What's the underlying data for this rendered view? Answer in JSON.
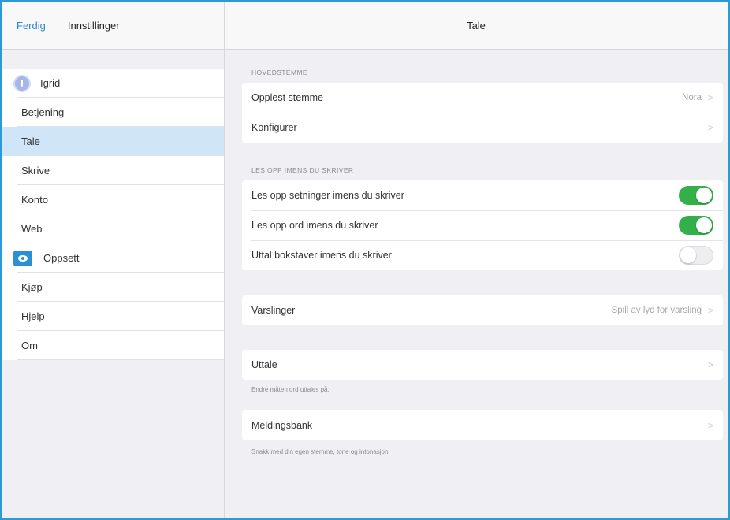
{
  "sidebar": {
    "done_label": "Ferdig",
    "title": "Innstillinger",
    "items": [
      {
        "label": "Igrid",
        "icon": "user-avatar-icon"
      },
      {
        "label": "Betjening"
      },
      {
        "label": "Tale",
        "active": true
      },
      {
        "label": "Skrive"
      },
      {
        "label": "Konto"
      },
      {
        "label": "Web"
      },
      {
        "label": "Oppsett",
        "icon": "eye-icon"
      },
      {
        "label": "Kjøp"
      },
      {
        "label": "Hjelp"
      },
      {
        "label": "Om"
      }
    ]
  },
  "main": {
    "title": "Tale",
    "voice_section": {
      "header": "HOVEDSTEMME",
      "rows": [
        {
          "label": "Opplest stemme",
          "value": "Nora",
          "chevron": ">"
        },
        {
          "label": "Konfigurer",
          "chevron": ">"
        }
      ]
    },
    "typing_section": {
      "header": "LES OPP IMENS DU SKRIVER",
      "rows": [
        {
          "label": "Les opp setninger imens du skriver",
          "toggle": true
        },
        {
          "label": "Les opp ord imens du skriver",
          "toggle": true
        },
        {
          "label": "Uttal bokstaver imens du skriver",
          "toggle": false
        }
      ]
    },
    "notifications": {
      "label": "Varslinger",
      "value": "Spill av lyd for varsling",
      "chevron": ">"
    },
    "pronounce": {
      "label": "Uttale",
      "chevron": ">",
      "footer": "Endre måten ord uttales på."
    },
    "message_bank": {
      "label": "Meldingsbank",
      "chevron": ">",
      "footer": "Snakk med din egen stemme, tone og intonasjon."
    }
  },
  "colors": {
    "accent": "#2a86d8",
    "toggle_on": "#34b04a",
    "selected_row": "#cfe6f9",
    "frame_border": "#2a9bd4"
  }
}
